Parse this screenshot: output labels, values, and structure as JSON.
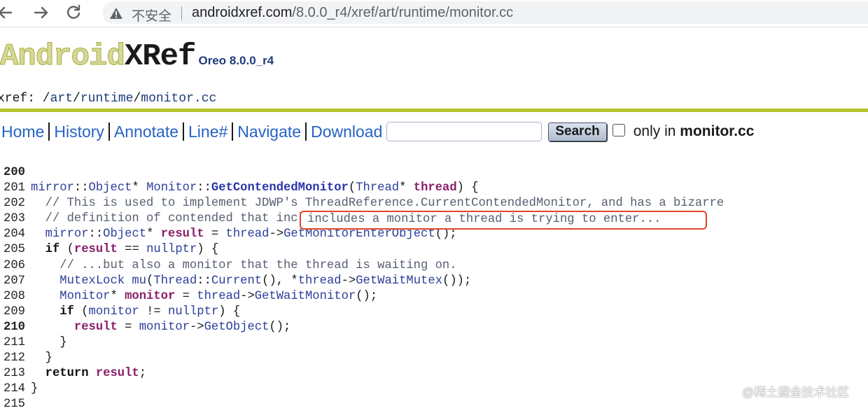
{
  "browser": {
    "back_icon": "arrow-left-icon",
    "forward_icon": "arrow-right-icon",
    "reload_icon": "reload-icon",
    "security_icon": "warning-triangle-icon",
    "security_label": "不安全",
    "url_host": "androidxref.com",
    "url_path": "/8.0.0_r4/xref/art/runtime/monitor.cc"
  },
  "header": {
    "logo_android": "Android",
    "logo_xref": "XRef",
    "version": "Oreo 8.0.0_r4",
    "breadcrumb": {
      "prefix": "xref: /",
      "parts": [
        "art",
        "runtime",
        "monitor.cc"
      ],
      "separator": "/"
    }
  },
  "menu": {
    "items": [
      "Home",
      "History",
      "Annotate",
      "Line#",
      "Navigate",
      "Download"
    ],
    "search_value": "",
    "search_button": "Search",
    "only_in_label": "only in",
    "only_in_file": "monitor.cc",
    "only_in_checked": false
  },
  "code": {
    "lines": [
      {
        "n": "200",
        "bold": true,
        "tokens": []
      },
      {
        "n": "201",
        "tokens": [
          {
            "t": "mirror",
            "c": "type"
          },
          {
            "t": "::",
            "c": "plain"
          },
          {
            "t": "Object",
            "c": "type"
          },
          {
            "t": "* ",
            "c": "plain"
          },
          {
            "t": "Monitor",
            "c": "type"
          },
          {
            "t": "::",
            "c": "plain"
          },
          {
            "t": "GetContendedMonitor",
            "c": "fn"
          },
          {
            "t": "(",
            "c": "plain"
          },
          {
            "t": "Thread",
            "c": "type"
          },
          {
            "t": "* ",
            "c": "plain"
          },
          {
            "t": "thread",
            "c": "var"
          },
          {
            "t": ") {",
            "c": "plain"
          }
        ]
      },
      {
        "n": "202",
        "tokens": [
          {
            "t": "  // This is used to implement JDWP's ThreadReference.CurrentContendedMonitor, and has a bizarre",
            "c": "comment"
          }
        ]
      },
      {
        "n": "203",
        "tokens": [
          {
            "t": "  // definition of contended that includes a monitor a thread is trying to enter...",
            "c": "comment"
          }
        ]
      },
      {
        "n": "204",
        "tokens": [
          {
            "t": "  ",
            "c": "plain"
          },
          {
            "t": "mirror",
            "c": "type"
          },
          {
            "t": "::",
            "c": "plain"
          },
          {
            "t": "Object",
            "c": "type"
          },
          {
            "t": "* ",
            "c": "plain"
          },
          {
            "t": "result",
            "c": "var"
          },
          {
            "t": " = ",
            "c": "plain"
          },
          {
            "t": "thread",
            "c": "ref"
          },
          {
            "t": "->",
            "c": "plain"
          },
          {
            "t": "GetMonitorEnterObject",
            "c": "ref"
          },
          {
            "t": "();",
            "c": "plain"
          }
        ]
      },
      {
        "n": "205",
        "tokens": [
          {
            "t": "  ",
            "c": "plain"
          },
          {
            "t": "if",
            "c": "kw"
          },
          {
            "t": " (",
            "c": "plain"
          },
          {
            "t": "result",
            "c": "var"
          },
          {
            "t": " == ",
            "c": "plain"
          },
          {
            "t": "nullptr",
            "c": "ref"
          },
          {
            "t": ") {",
            "c": "plain"
          }
        ]
      },
      {
        "n": "206",
        "tokens": [
          {
            "t": "    // ...but also a monitor that the thread is waiting on.",
            "c": "comment"
          }
        ]
      },
      {
        "n": "207",
        "tokens": [
          {
            "t": "    ",
            "c": "plain"
          },
          {
            "t": "MutexLock",
            "c": "type"
          },
          {
            "t": " ",
            "c": "plain"
          },
          {
            "t": "mu",
            "c": "ref"
          },
          {
            "t": "(",
            "c": "plain"
          },
          {
            "t": "Thread",
            "c": "type"
          },
          {
            "t": "::",
            "c": "plain"
          },
          {
            "t": "Current",
            "c": "ref"
          },
          {
            "t": "(), *",
            "c": "plain"
          },
          {
            "t": "thread",
            "c": "ref"
          },
          {
            "t": "->",
            "c": "plain"
          },
          {
            "t": "GetWaitMutex",
            "c": "ref"
          },
          {
            "t": "());",
            "c": "plain"
          }
        ]
      },
      {
        "n": "208",
        "tokens": [
          {
            "t": "    ",
            "c": "plain"
          },
          {
            "t": "Monitor",
            "c": "type"
          },
          {
            "t": "* ",
            "c": "plain"
          },
          {
            "t": "monitor",
            "c": "var"
          },
          {
            "t": " = ",
            "c": "plain"
          },
          {
            "t": "thread",
            "c": "ref"
          },
          {
            "t": "->",
            "c": "plain"
          },
          {
            "t": "GetWaitMonitor",
            "c": "ref"
          },
          {
            "t": "();",
            "c": "plain"
          }
        ]
      },
      {
        "n": "209",
        "tokens": [
          {
            "t": "    ",
            "c": "plain"
          },
          {
            "t": "if",
            "c": "kw"
          },
          {
            "t": " (",
            "c": "plain"
          },
          {
            "t": "monitor",
            "c": "ref"
          },
          {
            "t": " != ",
            "c": "plain"
          },
          {
            "t": "nullptr",
            "c": "ref"
          },
          {
            "t": ") {",
            "c": "plain"
          }
        ]
      },
      {
        "n": "210",
        "bold": true,
        "tokens": [
          {
            "t": "      ",
            "c": "plain"
          },
          {
            "t": "result",
            "c": "var"
          },
          {
            "t": " = ",
            "c": "plain"
          },
          {
            "t": "monitor",
            "c": "ref"
          },
          {
            "t": "->",
            "c": "plain"
          },
          {
            "t": "GetObject",
            "c": "ref"
          },
          {
            "t": "();",
            "c": "plain"
          }
        ]
      },
      {
        "n": "211",
        "tokens": [
          {
            "t": "    }",
            "c": "plain"
          }
        ]
      },
      {
        "n": "212",
        "tokens": [
          {
            "t": "  }",
            "c": "plain"
          }
        ]
      },
      {
        "n": "213",
        "tokens": [
          {
            "t": "  ",
            "c": "plain"
          },
          {
            "t": "return",
            "c": "kw"
          },
          {
            "t": " ",
            "c": "plain"
          },
          {
            "t": "result",
            "c": "var"
          },
          {
            "t": ";",
            "c": "plain"
          }
        ]
      },
      {
        "n": "214",
        "tokens": [
          {
            "t": "}",
            "c": "plain"
          }
        ]
      },
      {
        "n": "215",
        "tokens": []
      }
    ],
    "highlight_text": "includes a monitor a thread is trying to enter...",
    "highlight_color": "#e0452b"
  },
  "watermark": "@稀土掘金技术社区"
}
